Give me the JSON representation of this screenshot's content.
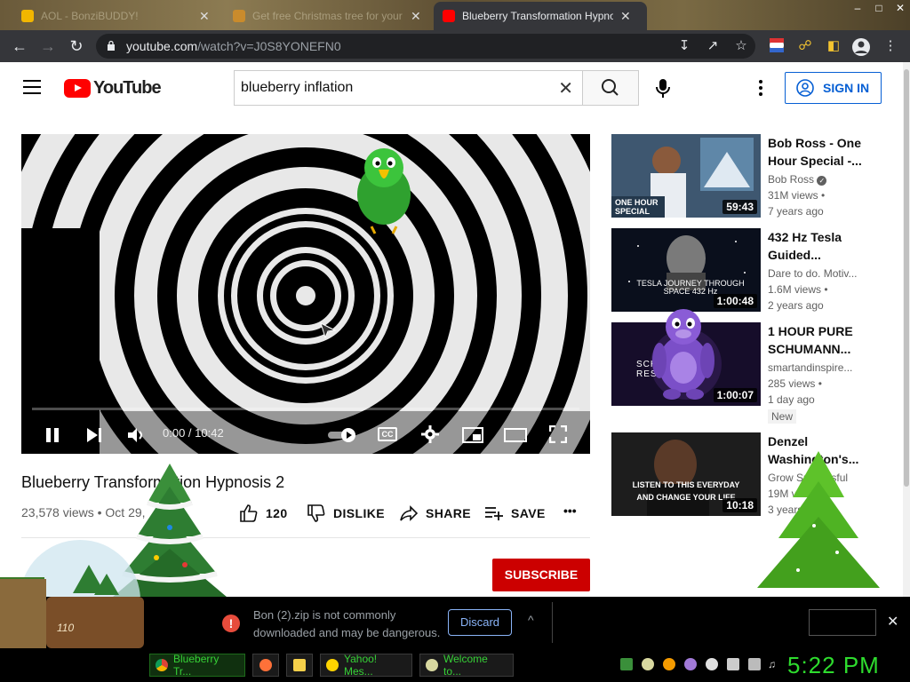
{
  "browser": {
    "tabs": [
      {
        "title": "AOL - BonziBUDDY!",
        "close": "✕"
      },
      {
        "title": "Get free Christmas tree for your",
        "close": "✕"
      },
      {
        "title": "Blueberry Transformation Hypno",
        "close": "✕"
      }
    ],
    "url_host": "youtube.com",
    "url_path": "/watch?v=J0S8YONEFN0"
  },
  "youtube": {
    "logo_text": "YouTube",
    "search_value": "blueberry inflation",
    "sign_in": "SIGN IN"
  },
  "video": {
    "time": "0:00 / 10:42",
    "cc": "CC",
    "title": "Blueberry Transformation Hypnosis 2",
    "stats": "23,578 views • Oct 29,",
    "likes": "120",
    "dislike": "DISLIKE",
    "share": "SHARE",
    "save": "SAVE",
    "more": "•••",
    "subscribe": "SUBSCRIBE"
  },
  "recommendations": [
    {
      "title": "Bob Ross - One Hour Special -...",
      "channel": "Bob Ross",
      "views": "31M views •",
      "age": "7 years ago",
      "duration": "59:43",
      "overlay": "ONE HOUR SPECIAL"
    },
    {
      "title": "432 Hz Tesla Guided...",
      "channel": "Dare to do. Motiv...",
      "views": "1.6M views •",
      "age": "2 years ago",
      "duration": "1:00:48",
      "overlay": "TESLA JOURNEY THROUGH SPACE 432 Hz"
    },
    {
      "title": "1 HOUR PURE SCHUMANN...",
      "channel": "smartandinspire...",
      "views": "285 views •",
      "age": "1 day ago",
      "duration": "1:00:07",
      "badge": "New",
      "overlay": "SCHUMANN RESONANCE"
    },
    {
      "title": "Denzel Washington's...",
      "channel": "Grow Successful",
      "views": "19M views",
      "age": "3 years ago",
      "duration": "10:18",
      "overlay": "LISTEN TO THIS EVERYDAY AND CHANGE YOUR LIFE"
    }
  ],
  "download": {
    "message": "Bon (2).zip is not commonly downloaded and may be dangerous.",
    "discard": "Discard",
    "caret": "^",
    "close": "✕"
  },
  "taskbar": {
    "buttons": [
      "Blueberry Tr...",
      "Yahoo! Mes...",
      "Welcome to..."
    ],
    "clock": "5:22 PM"
  },
  "desktop": {
    "snowglobe_label": "110"
  },
  "colors": {
    "yt_red": "#ff0000",
    "subscribe_red": "#cc0000",
    "link_blue": "#065fd4",
    "clock_green": "#2edc2e"
  }
}
